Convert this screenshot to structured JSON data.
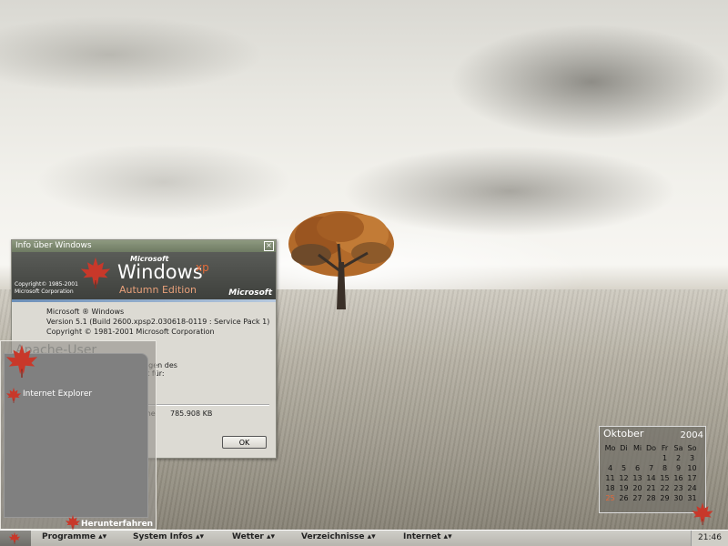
{
  "about_window": {
    "title": "Info über Windows",
    "close_glyph": "×",
    "banner": {
      "microsoft_small": "Microsoft",
      "windows": "Windows",
      "xp": "xp",
      "edition": "Autumn Edition",
      "copyright_line1": "Copyright© 1985-2001",
      "copyright_line2": "Microsoft Corporation",
      "ms_logo": "Microsoft"
    },
    "body": {
      "product": "Microsoft ® Windows",
      "version": "Version 5.1 (Build 2600.xpsp2.030618-0119 : Service Pack 1)",
      "copyright": "Copyright © 1981-2001 Microsoft Corporation",
      "fragment_line1": "ungen des",
      "fragment_line2": "ert für:",
      "memory_label_fragment": "me",
      "memory_value": "785.908 KB"
    },
    "ok_label": "OK"
  },
  "start_menu": {
    "user": "Apache-User",
    "items": [
      {
        "label": "Internet Explorer"
      }
    ],
    "shutdown_label": "Herunterfahren"
  },
  "calendar": {
    "month": "Oktober",
    "year": "2004",
    "weekdays": [
      "Mo",
      "Di",
      "Mi",
      "Do",
      "Fr",
      "Sa",
      "So"
    ],
    "weeks": [
      [
        "",
        "",
        "",
        "",
        "1",
        "2",
        "3"
      ],
      [
        "4",
        "5",
        "6",
        "7",
        "8",
        "9",
        "10"
      ],
      [
        "11",
        "12",
        "13",
        "14",
        "15",
        "16",
        "17"
      ],
      [
        "18",
        "19",
        "20",
        "21",
        "22",
        "23",
        "24"
      ],
      [
        "25",
        "26",
        "27",
        "28",
        "29",
        "30",
        "31"
      ]
    ],
    "today": "25",
    "today_color": "#e4693a"
  },
  "taskbar": {
    "menus": [
      {
        "label": "Programme ▴▾"
      },
      {
        "label": "System Infos ▴▾"
      },
      {
        "label": "Wetter ▴▾"
      },
      {
        "label": "Verzeichnisse ▴▾"
      },
      {
        "label": "Internet ▴▾"
      }
    ],
    "clock": "21:46"
  },
  "colors": {
    "accent_leaf": "#c8382a",
    "banner_bg": "#4a4c48"
  }
}
